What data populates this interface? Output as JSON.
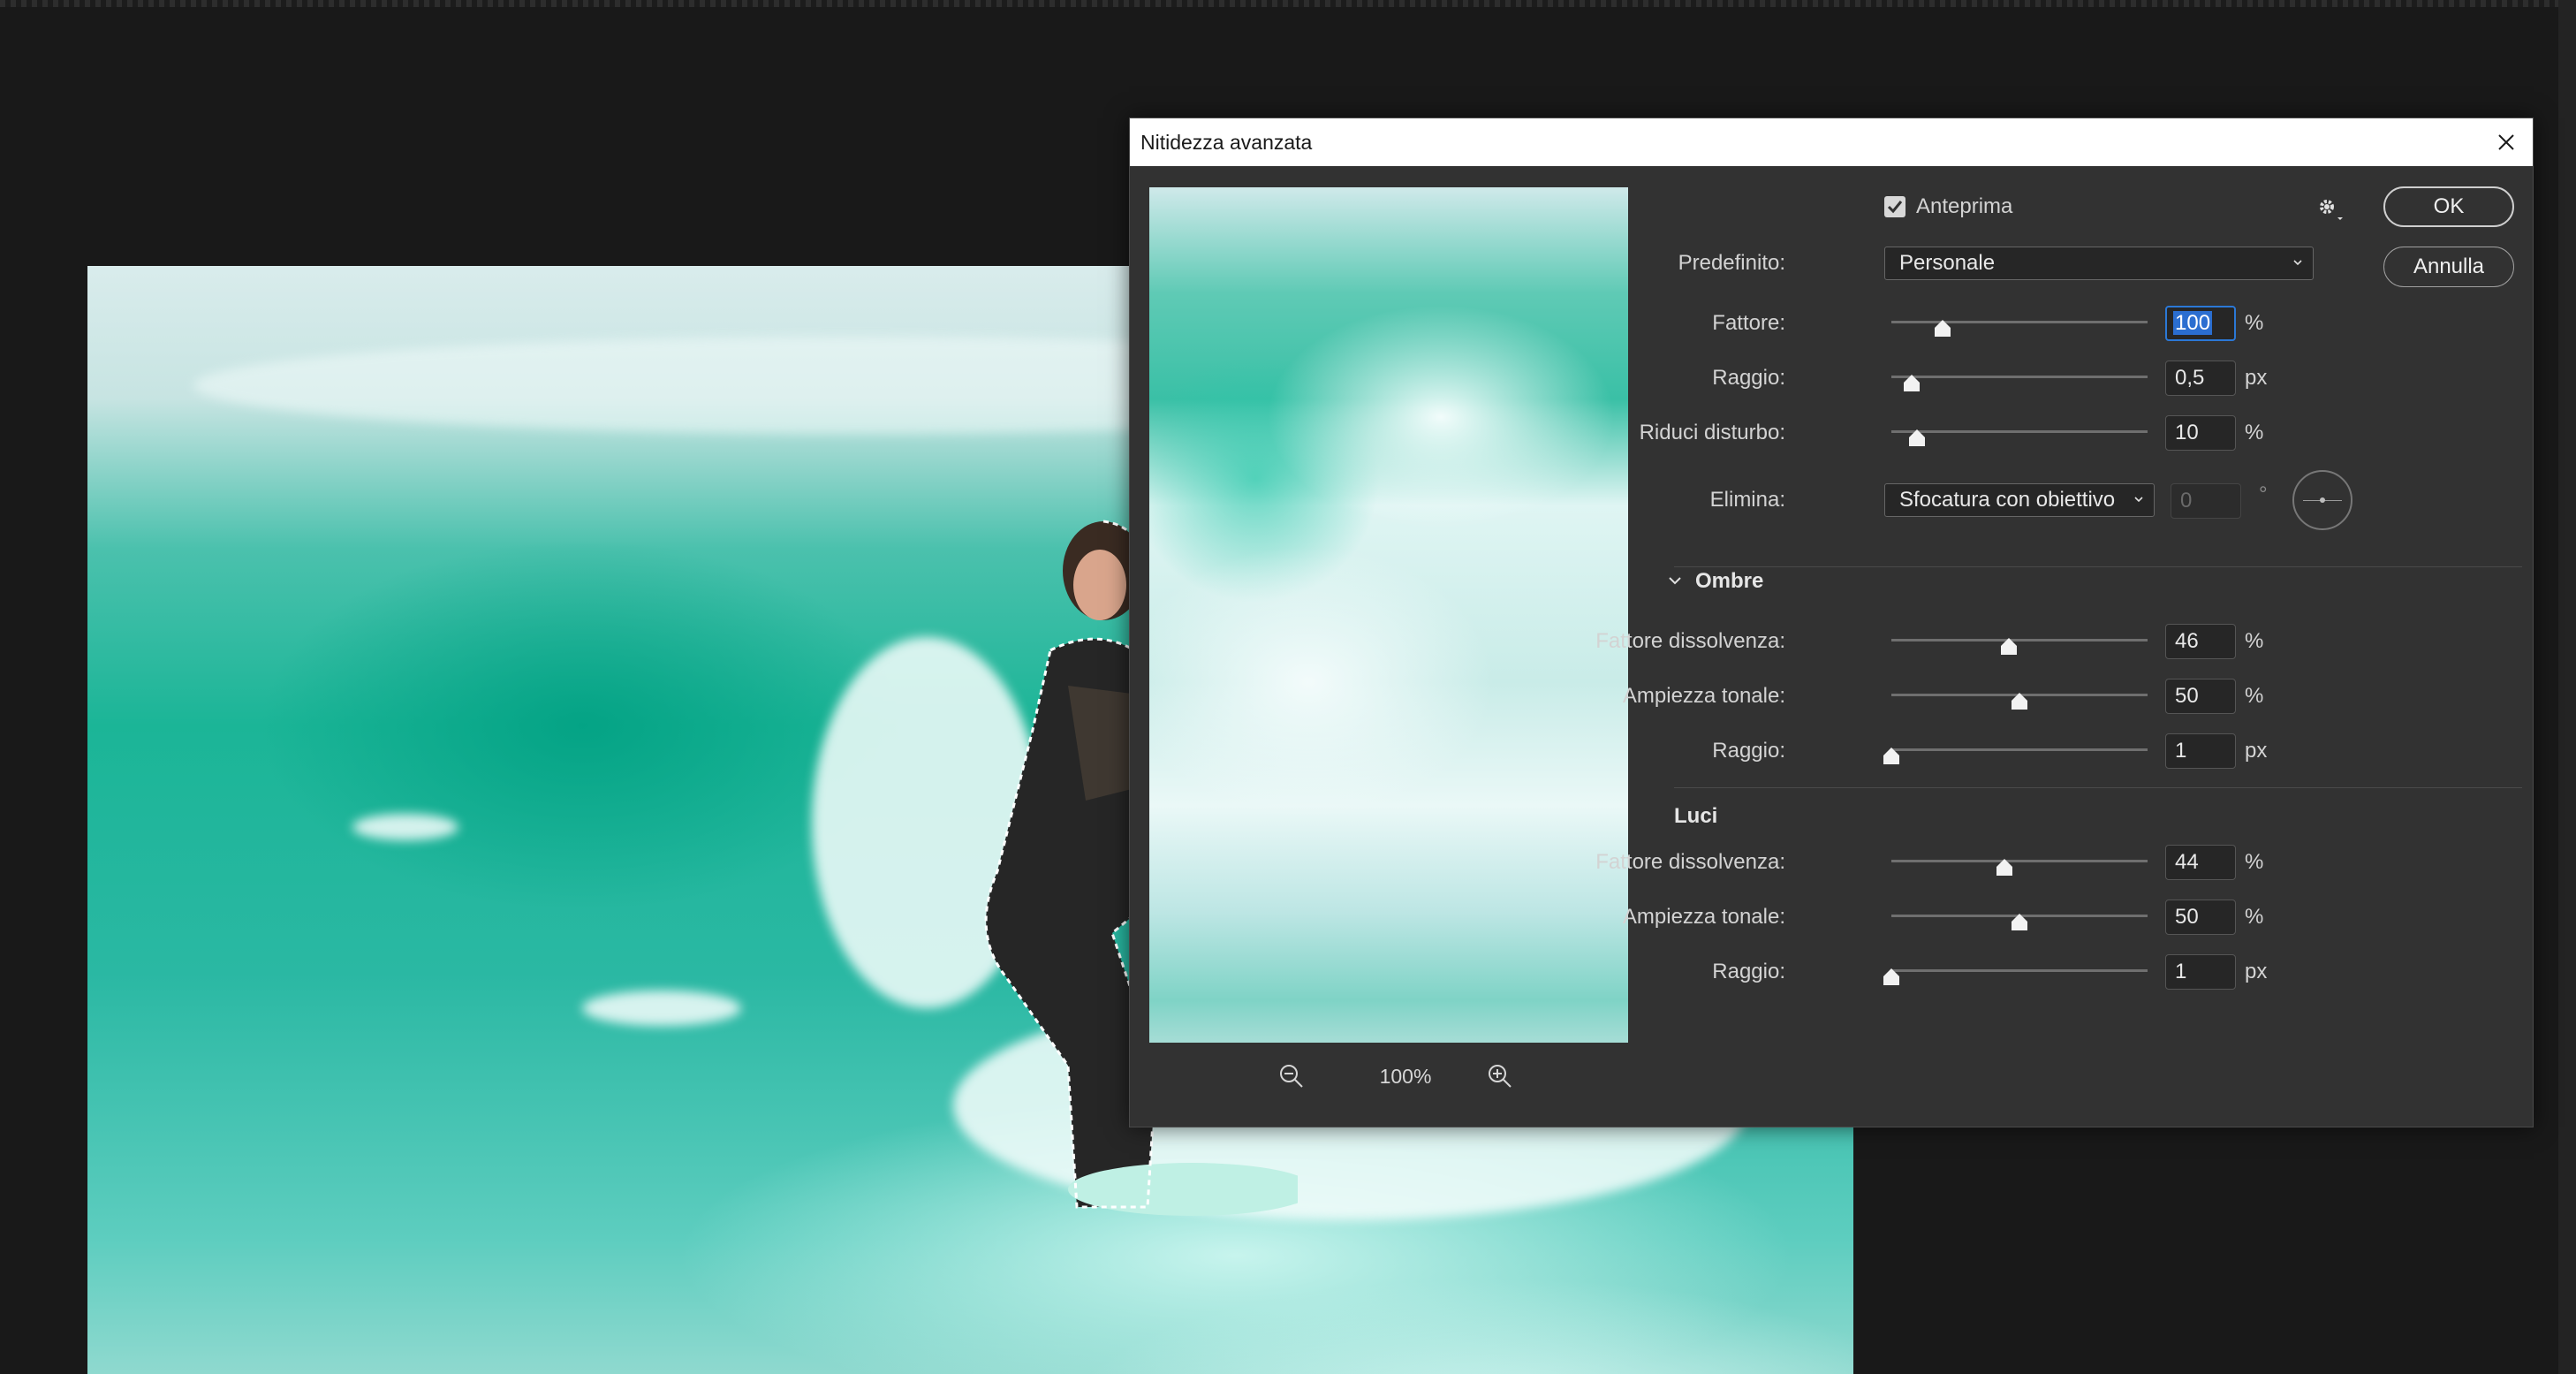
{
  "dialog": {
    "title": "Nitidezza avanzata",
    "preview_checkbox": {
      "label": "Anteprima",
      "checked": true
    },
    "preset": {
      "label": "Predefinito:",
      "value": "Personale"
    },
    "amount": {
      "label": "Fattore:",
      "value": "100",
      "unit": "%",
      "level": 0.2
    },
    "radius": {
      "label": "Raggio:",
      "value": "0,5",
      "unit": "px",
      "level": 0.08
    },
    "reduce_noise": {
      "label": "Riduci disturbo:",
      "value": "10",
      "unit": "%",
      "level": 0.1
    },
    "remove": {
      "label": "Elimina:",
      "value": "Sfocatura con obiettivo",
      "angle_value": "0",
      "angle_unit": "°"
    },
    "shadows": {
      "title": "Ombre",
      "fade": {
        "label": "Fattore dissolvenza:",
        "value": "46",
        "unit": "%",
        "level": 0.46
      },
      "tonal_width": {
        "label": "Ampiezza tonale:",
        "value": "50",
        "unit": "%",
        "level": 0.5
      },
      "radius": {
        "label": "Raggio:",
        "value": "1",
        "unit": "px",
        "level": 0.0
      }
    },
    "highlights": {
      "title": "Luci",
      "fade": {
        "label": "Fattore dissolvenza:",
        "value": "44",
        "unit": "%",
        "level": 0.44
      },
      "tonal_width": {
        "label": "Ampiezza tonale:",
        "value": "50",
        "unit": "%",
        "level": 0.5
      },
      "radius": {
        "label": "Raggio:",
        "value": "1",
        "unit": "px",
        "level": 0.0
      }
    },
    "zoom": "100%",
    "ok_label": "OK",
    "cancel_label": "Annulla"
  },
  "icons": {
    "close": "close-icon",
    "gear": "gear-icon",
    "zoom_in": "zoom-in-icon",
    "zoom_out": "zoom-out-icon",
    "chevron": "chevron-down-icon"
  },
  "colors": {
    "dialog_bg": "#323232",
    "app_bg": "#191919",
    "accent": "#2b78d6"
  }
}
